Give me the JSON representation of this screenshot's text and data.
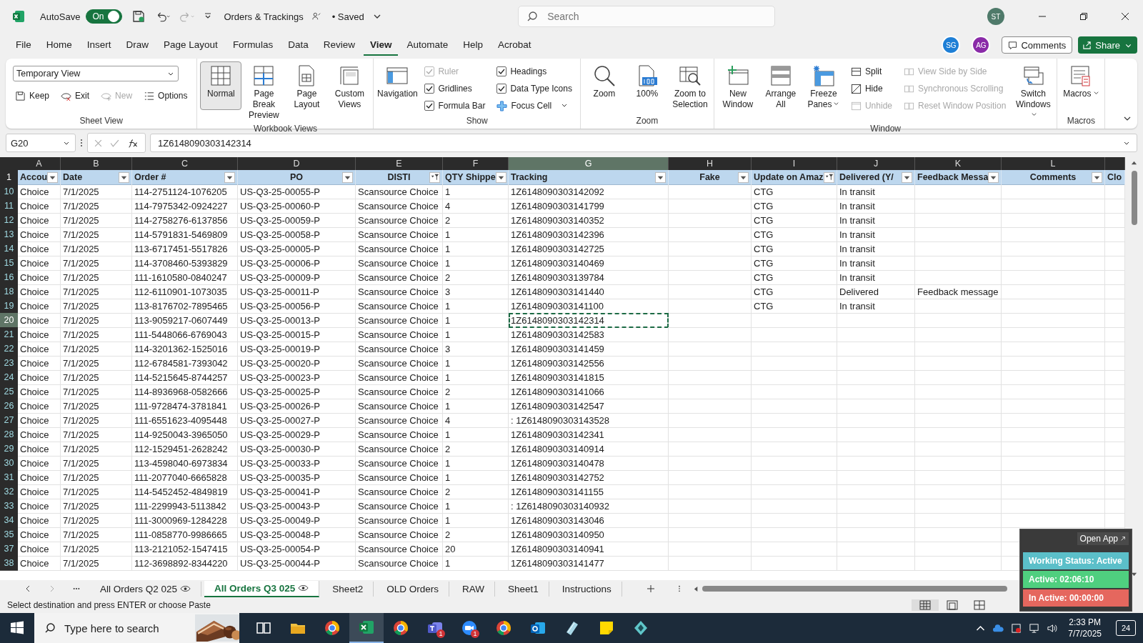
{
  "title_bar": {
    "autosave": {
      "label": "AutoSave",
      "on": true,
      "state_label": "On"
    },
    "document_title": "Orders & Trackings",
    "save_status": "• Saved",
    "search_placeholder": "Search",
    "user_initials": "ST"
  },
  "menu_tabs": [
    {
      "label": "File",
      "selected": false
    },
    {
      "label": "Home",
      "selected": false
    },
    {
      "label": "Insert",
      "selected": false
    },
    {
      "label": "Draw",
      "selected": false
    },
    {
      "label": "Page Layout",
      "selected": false
    },
    {
      "label": "Formulas",
      "selected": false
    },
    {
      "label": "Data",
      "selected": false
    },
    {
      "label": "Review",
      "selected": false
    },
    {
      "label": "View",
      "selected": true
    },
    {
      "label": "Automate",
      "selected": false
    },
    {
      "label": "Help",
      "selected": false
    },
    {
      "label": "Acrobat",
      "selected": false
    }
  ],
  "collaborators": [
    {
      "initials": "SG",
      "color": "#1e7fd6"
    },
    {
      "initials": "AG",
      "color": "#8a2ba8"
    }
  ],
  "comments_label": "Comments",
  "share_label": "Share",
  "ribbon": {
    "groups": [
      {
        "label": "Sheet View",
        "kind": "sheet_view",
        "view_select": "Temporary View",
        "items": [
          {
            "label": "Keep",
            "disabled": false
          },
          {
            "label": "Exit",
            "disabled": false
          },
          {
            "label": "New",
            "disabled": true
          },
          {
            "label": "Options",
            "disabled": false
          }
        ]
      },
      {
        "label": "Workbook Views",
        "kind": "buttons",
        "items": [
          {
            "kind": "large",
            "label": "Normal",
            "selected": true
          },
          {
            "kind": "large",
            "label": "Page Break Preview",
            "selected": false
          },
          {
            "kind": "large",
            "label": "Page Layout",
            "selected": false
          },
          {
            "kind": "large",
            "label": "Custom Views",
            "selected": false
          }
        ]
      },
      {
        "label": "Show",
        "kind": "buttons",
        "items": [
          {
            "kind": "large",
            "label": "Navigation"
          },
          {
            "kind": "column",
            "items": [
              {
                "kind": "check",
                "label": "Ruler",
                "checked": true,
                "disabled": true
              },
              {
                "kind": "check",
                "label": "Gridlines",
                "checked": true,
                "disabled": false
              },
              {
                "kind": "check",
                "label": "Formula Bar",
                "checked": true,
                "disabled": false
              }
            ]
          },
          {
            "kind": "column",
            "items": [
              {
                "kind": "check",
                "label": "Headings",
                "checked": true,
                "disabled": false
              },
              {
                "kind": "check",
                "label": "Data Type Icons",
                "checked": true,
                "disabled": false
              },
              {
                "kind": "small",
                "label": "Focus Cell",
                "disabled": false,
                "dropdown": true
              }
            ]
          }
        ]
      },
      {
        "label": "Zoom",
        "kind": "buttons",
        "items": [
          {
            "kind": "large",
            "label": "Zoom"
          },
          {
            "kind": "large",
            "label": "100%"
          },
          {
            "kind": "large",
            "label": "Zoom to Selection"
          }
        ]
      },
      {
        "label": "Window",
        "kind": "buttons",
        "items": [
          {
            "kind": "large",
            "label": "New Window"
          },
          {
            "kind": "large",
            "label": "Arrange All"
          },
          {
            "kind": "large",
            "label": "Freeze Panes",
            "dropdown": true
          },
          {
            "kind": "column",
            "items": [
              {
                "kind": "small",
                "label": "Split",
                "disabled": false
              },
              {
                "kind": "small",
                "label": "Hide",
                "disabled": false
              },
              {
                "kind": "small",
                "label": "Unhide",
                "disabled": true
              }
            ]
          },
          {
            "kind": "column",
            "items": [
              {
                "kind": "small",
                "label": "View Side by Side",
                "disabled": true
              },
              {
                "kind": "small",
                "label": "Synchronous Scrolling",
                "disabled": true
              },
              {
                "kind": "small",
                "label": "Reset Window Position",
                "disabled": true
              }
            ]
          },
          {
            "kind": "large",
            "label": "Switch Windows",
            "dropdown": true
          }
        ]
      },
      {
        "label": "Macros",
        "kind": "buttons",
        "items": [
          {
            "kind": "large",
            "label": "Macros",
            "dropdown": true
          }
        ]
      }
    ]
  },
  "formula_bar": {
    "name_box": "G20",
    "formula": "1Z6148090303142314"
  },
  "sheet": {
    "header_row_number": "1",
    "columns": [
      {
        "letter": "A",
        "header": "Accou",
        "filtered": false,
        "selected": false
      },
      {
        "letter": "B",
        "header": "Date",
        "filtered": false,
        "selected": false
      },
      {
        "letter": "C",
        "header": "Order #",
        "filtered": false,
        "selected": false
      },
      {
        "letter": "D",
        "header": "PO",
        "filtered": false,
        "selected": false
      },
      {
        "letter": "E",
        "header": "DISTI",
        "filtered": true,
        "selected": false
      },
      {
        "letter": "F",
        "header": "QTY Shippe",
        "filtered": false,
        "selected": false
      },
      {
        "letter": "G",
        "header": "Tracking",
        "filtered": false,
        "selected": true
      },
      {
        "letter": "H",
        "header": "Fake",
        "filtered": false,
        "selected": false
      },
      {
        "letter": "I",
        "header": "Update on Amaz",
        "filtered": true,
        "selected": false
      },
      {
        "letter": "J",
        "header": "Delivered (Y/",
        "filtered": false,
        "selected": false
      },
      {
        "letter": "K",
        "header": "Feedback Messa",
        "filtered": false,
        "selected": false
      },
      {
        "letter": "L",
        "header": "Comments",
        "filtered": false,
        "selected": false
      },
      {
        "header": "Clo"
      }
    ],
    "rows": [
      {
        "number": "10",
        "selected": false,
        "cells": {
          "account": "Choice",
          "date": "7/1/2025",
          "order": "114-2751124-1076205",
          "po": "US-Q3-25-00055-P",
          "disti": "Scansource Choice",
          "qty": "1",
          "tracking": "1Z6148090303142092",
          "update": "CTG",
          "delivered": "In transit"
        }
      },
      {
        "number": "11",
        "selected": false,
        "cells": {
          "account": "Choice",
          "date": "7/1/2025",
          "order": "114-7975342-0924227",
          "po": "US-Q3-25-00060-P",
          "disti": "Scansource Choice",
          "qty": "4",
          "tracking": "1Z6148090303141799",
          "update": "CTG",
          "delivered": "In transit"
        }
      },
      {
        "number": "12",
        "selected": false,
        "cells": {
          "account": "Choice",
          "date": "7/1/2025",
          "order": "114-2758276-6137856",
          "po": "US-Q3-25-00059-P",
          "disti": "Scansource Choice",
          "qty": "2",
          "tracking": "1Z6148090303140352",
          "update": "CTG",
          "delivered": "In transit"
        }
      },
      {
        "number": "13",
        "selected": false,
        "cells": {
          "account": "Choice",
          "date": "7/1/2025",
          "order": "114-5791831-5469809",
          "po": "US-Q3-25-00058-P",
          "disti": "Scansource Choice",
          "qty": "1",
          "tracking": "1Z6148090303142396",
          "update": "CTG",
          "delivered": "In transit"
        }
      },
      {
        "number": "14",
        "selected": false,
        "cells": {
          "account": "Choice",
          "date": "7/1/2025",
          "order": "113-6717451-5517826",
          "po": "US-Q3-25-00005-P",
          "disti": "Scansource Choice",
          "qty": "1",
          "tracking": "1Z6148090303142725",
          "update": "CTG",
          "delivered": "In transit"
        }
      },
      {
        "number": "15",
        "selected": false,
        "cells": {
          "account": "Choice",
          "date": "7/1/2025",
          "order": "114-3708460-5393829",
          "po": "US-Q3-25-00006-P",
          "disti": "Scansource Choice",
          "qty": "1",
          "tracking": "1Z6148090303140469",
          "update": "CTG",
          "delivered": "In transit"
        }
      },
      {
        "number": "16",
        "selected": false,
        "cells": {
          "account": "Choice",
          "date": "7/1/2025",
          "order": "111-1610580-0840247",
          "po": "US-Q3-25-00009-P",
          "disti": "Scansource Choice",
          "qty": "2",
          "tracking": "1Z6148090303139784",
          "update": "CTG",
          "delivered": "In transit"
        }
      },
      {
        "number": "18",
        "selected": false,
        "cells": {
          "account": "Choice",
          "date": "7/1/2025",
          "order": "112-6110901-1073035",
          "po": "US-Q3-25-00011-P",
          "disti": "Scansource Choice",
          "qty": "3",
          "tracking": "1Z6148090303141440",
          "update": "CTG",
          "delivered": "Delivered",
          "feedback": "Feedback message"
        }
      },
      {
        "number": "19",
        "selected": false,
        "cells": {
          "account": "Choice",
          "date": "7/1/2025",
          "order": "113-8176702-7895465",
          "po": "US-Q3-25-00056-P",
          "disti": "Scansource Choice",
          "qty": "1",
          "tracking": "1Z6148090303141100",
          "update": "CTG",
          "delivered": "In transit"
        }
      },
      {
        "number": "20",
        "selected": true,
        "cells": {
          "account": "Choice",
          "date": "7/1/2025",
          "order": "113-9059217-0607449",
          "po": "US-Q3-25-00013-P",
          "disti": "Scansource Choice",
          "qty": "1",
          "tracking": "1Z6148090303142314"
        }
      },
      {
        "number": "21",
        "selected": false,
        "cells": {
          "account": "Choice",
          "date": "7/1/2025",
          "order": "111-5448066-6769043",
          "po": "US-Q3-25-00015-P",
          "disti": "Scansource Choice",
          "qty": "1",
          "tracking": "1Z6148090303142583"
        }
      },
      {
        "number": "22",
        "selected": false,
        "cells": {
          "account": "Choice",
          "date": "7/1/2025",
          "order": "114-3201362-1525016",
          "po": "US-Q3-25-00019-P",
          "disti": "Scansource Choice",
          "qty": "3",
          "tracking": "1Z6148090303141459"
        }
      },
      {
        "number": "23",
        "selected": false,
        "cells": {
          "account": "Choice",
          "date": "7/1/2025",
          "order": "112-6784581-7393042",
          "po": "US-Q3-25-00020-P",
          "disti": "Scansource Choice",
          "qty": "1",
          "tracking": "1Z6148090303142556"
        }
      },
      {
        "number": "24",
        "selected": false,
        "cells": {
          "account": "Choice",
          "date": "7/1/2025",
          "order": "114-5215645-8744257",
          "po": "US-Q3-25-00023-P",
          "disti": "Scansource Choice",
          "qty": "1",
          "tracking": "1Z6148090303141815"
        }
      },
      {
        "number": "25",
        "selected": false,
        "cells": {
          "account": "Choice",
          "date": "7/1/2025",
          "order": "114-8936968-0582666",
          "po": "US-Q3-25-00025-P",
          "disti": "Scansource Choice",
          "qty": "2",
          "tracking": "1Z6148090303141066"
        }
      },
      {
        "number": "26",
        "selected": false,
        "cells": {
          "account": "Choice",
          "date": "7/1/2025",
          "order": "111-9728474-3781841",
          "po": "US-Q3-25-00026-P",
          "disti": "Scansource Choice",
          "qty": "1",
          "tracking": "1Z6148090303142547"
        }
      },
      {
        "number": "27",
        "selected": false,
        "cells": {
          "account": "Choice",
          "date": "7/1/2025",
          "order": "111-6551623-4095448",
          "po": "US-Q3-25-00027-P",
          "disti": "Scansource Choice",
          "qty": "4",
          "tracking": ": 1Z6148090303143528"
        }
      },
      {
        "number": "28",
        "selected": false,
        "cells": {
          "account": "Choice",
          "date": "7/1/2025",
          "order": "114-9250043-3965050",
          "po": "US-Q3-25-00029-P",
          "disti": "Scansource Choice",
          "qty": "1",
          "tracking": "1Z6148090303142341"
        }
      },
      {
        "number": "29",
        "selected": false,
        "cells": {
          "account": "Choice",
          "date": "7/1/2025",
          "order": "112-1529451-2628242",
          "po": "US-Q3-25-00030-P",
          "disti": "Scansource Choice",
          "qty": "2",
          "tracking": "1Z6148090303140914"
        }
      },
      {
        "number": "30",
        "selected": false,
        "cells": {
          "account": "Choice",
          "date": "7/1/2025",
          "order": "113-4598040-6973834",
          "po": "US-Q3-25-00033-P",
          "disti": "Scansource Choice",
          "qty": "1",
          "tracking": "1Z6148090303140478"
        }
      },
      {
        "number": "31",
        "selected": false,
        "cells": {
          "account": "Choice",
          "date": "7/1/2025",
          "order": "111-2077040-6665828",
          "po": "US-Q3-25-00035-P",
          "disti": "Scansource Choice",
          "qty": "1",
          "tracking": "1Z6148090303142752"
        }
      },
      {
        "number": "32",
        "selected": false,
        "cells": {
          "account": "Choice",
          "date": "7/1/2025",
          "order": "114-5452452-4849819",
          "po": "US-Q3-25-00041-P",
          "disti": "Scansource Choice",
          "qty": "2",
          "tracking": "1Z6148090303141155"
        }
      },
      {
        "number": "33",
        "selected": false,
        "cells": {
          "account": "Choice",
          "date": "7/1/2025",
          "order": "111-2299943-5113842",
          "po": "US-Q3-25-00043-P",
          "disti": "Scansource Choice",
          "qty": "1",
          "tracking": ": 1Z6148090303140932"
        }
      },
      {
        "number": "34",
        "selected": false,
        "cells": {
          "account": "Choice",
          "date": "7/1/2025",
          "order": "111-3000969-1284228",
          "po": "US-Q3-25-00049-P",
          "disti": "Scansource Choice",
          "qty": "1",
          "tracking": "1Z6148090303143046"
        }
      },
      {
        "number": "35",
        "selected": false,
        "cells": {
          "account": "Choice",
          "date": "7/1/2025",
          "order": "111-0858770-9986665",
          "po": "US-Q3-25-00048-P",
          "disti": "Scansource Choice",
          "qty": "2",
          "tracking": "1Z6148090303140950"
        }
      },
      {
        "number": "37",
        "selected": false,
        "cells": {
          "account": "Choice",
          "date": "7/1/2025",
          "order": "113-2121052-1547415",
          "po": "US-Q3-25-00054-P",
          "disti": "Scansource Choice",
          "qty": "20",
          "tracking": "1Z6148090303140941"
        }
      },
      {
        "number": "38",
        "selected": false,
        "cells": {
          "account": "Choice",
          "date": "7/1/2025",
          "order": "112-3698892-8344220",
          "po": "US-Q3-25-00044-P",
          "disti": "Scansource Choice",
          "qty": "1",
          "tracking": "1Z6148090303141477"
        }
      }
    ]
  },
  "sheet_tabs": [
    {
      "label": "All Orders Q2 025",
      "selected": false,
      "eye": true
    },
    {
      "label": "All Orders Q3 025",
      "selected": true,
      "eye": true
    },
    {
      "label": "Sheet2",
      "selected": false,
      "eye": false
    },
    {
      "label": "OLD Orders",
      "selected": false,
      "eye": false
    },
    {
      "label": "RAW",
      "selected": false,
      "eye": false
    },
    {
      "label": "Sheet1",
      "selected": false,
      "eye": false
    },
    {
      "label": "Instructions",
      "selected": false,
      "eye": false
    }
  ],
  "status_bar": {
    "message": "Select destination and press ENTER or choose Paste",
    "view_buttons": [
      {
        "selected": true
      },
      {
        "selected": false
      },
      {
        "selected": false
      }
    ]
  },
  "tracker_widget": {
    "open_app": "Open App",
    "items": [
      {
        "label": "Working Status: Active",
        "color": "#5bbfc9"
      },
      {
        "label": "Active: 02:06:10",
        "color": "#4fcf7f"
      },
      {
        "label": "In Active: 00:00:00",
        "color": "#e5675e"
      }
    ]
  },
  "taskbar": {
    "search_placeholder": "Type here to search",
    "apps": [
      {
        "selected": false
      },
      {
        "selected": false
      },
      {
        "selected": false
      },
      {
        "selected": true
      },
      {
        "selected": false
      },
      {
        "selected": false,
        "badge": "1"
      },
      {
        "selected": false,
        "badge": "1"
      },
      {
        "selected": false
      },
      {
        "selected": false
      },
      {
        "selected": false
      },
      {
        "selected": false
      },
      {
        "selected": false
      }
    ],
    "time": "2:33 PM",
    "date": "7/7/2025",
    "notifications": "24"
  }
}
